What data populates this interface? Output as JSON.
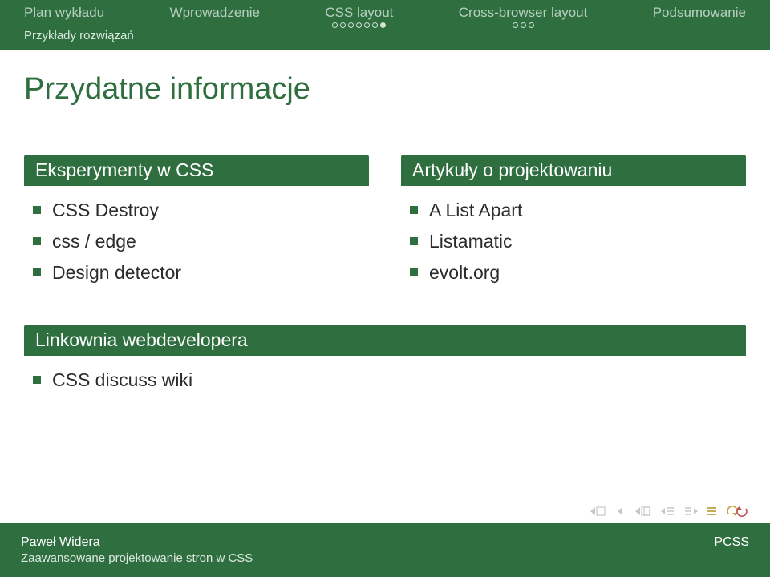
{
  "nav": {
    "items": [
      {
        "label": "Plan wykładu"
      },
      {
        "label": "Wprowadzenie"
      },
      {
        "label": "CSS layout"
      },
      {
        "label": "Cross-browser layout"
      },
      {
        "label": "Podsumowanie"
      }
    ],
    "subsection": "Przykłady rozwiązań"
  },
  "title": "Przydatne informacje",
  "block_left": {
    "title": "Eksperymenty w CSS",
    "items": [
      "CSS Destroy",
      "css / edge",
      "Design detector"
    ]
  },
  "block_right": {
    "title": "Artykuły o projektowaniu",
    "items": [
      "A List Apart",
      "Listamatic",
      "evolt.org"
    ]
  },
  "block_bottom": {
    "title": "Linkownia webdevelopera",
    "items": [
      "CSS discuss wiki"
    ]
  },
  "footer": {
    "author": "Paweł Widera",
    "institution": "PCSS",
    "subtitle": "Zaawansowane projektowanie stron w CSS"
  },
  "colors": {
    "brand": "#2e6e3f",
    "nav_arrow": "#c7c7c7",
    "nav_outline": "#c7c7c7",
    "nav_list_icon": "#bfa24a",
    "nav_refresh": "#bfa24a",
    "nav_refresh_accent": "#c05050"
  }
}
